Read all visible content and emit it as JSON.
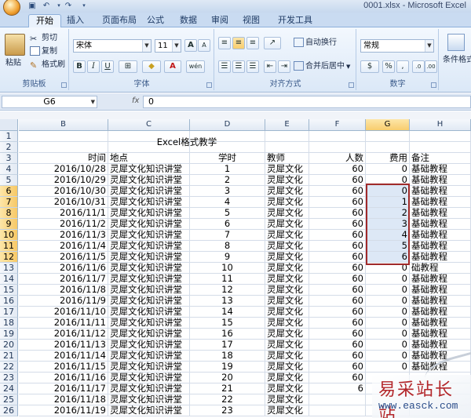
{
  "window": {
    "title": "0001.xlsx - Microsoft Excel"
  },
  "tabs": [
    "开始",
    "插入",
    "页面布局",
    "公式",
    "数据",
    "审阅",
    "视图",
    "开发工具"
  ],
  "ribbon": {
    "clipboard": {
      "label": "剪贴板",
      "paste": "粘贴",
      "cut": "剪切",
      "copy": "复制",
      "format_painter": "格式刷"
    },
    "font": {
      "label": "字体",
      "name": "宋体",
      "size": "11",
      "bold": "B",
      "italic": "I",
      "underline": "U",
      "grow": "A",
      "shrink": "A",
      "wen": "wén"
    },
    "alignment": {
      "label": "对齐方式",
      "wrap": "自动换行",
      "merge": "合并后居中"
    },
    "number": {
      "label": "数字",
      "format": "常规",
      "percent": "%",
      "comma": ","
    },
    "styles": {
      "conditional": "条件格式"
    }
  },
  "formula_bar": {
    "name_box": "G6",
    "fx": "fx",
    "value": "0"
  },
  "sheet": {
    "columns": [
      "B",
      "C",
      "D",
      "E",
      "F",
      "G",
      "H"
    ],
    "selected_column": "G",
    "selected_rows": [
      "6",
      "7",
      "8",
      "9",
      "10",
      "11",
      "12"
    ],
    "title": "Excel格式教学",
    "rows": [
      {
        "n": "1",
        "time": "",
        "place": "",
        "hours": "",
        "teacher": "",
        "count": "",
        "fee": "",
        "note": ""
      },
      {
        "n": "2",
        "time": "",
        "place": "",
        "hours": "",
        "teacher": "",
        "count": "",
        "fee": "",
        "note": ""
      },
      {
        "n": "3",
        "time": "时间",
        "place": "地点",
        "hours": "学时",
        "teacher": "教师",
        "count": "人数",
        "fee": "费用",
        "note": "备注"
      },
      {
        "n": "4",
        "time": "2016/10/28",
        "place": "灵犀文化知识讲堂",
        "hours": "1",
        "teacher": "灵犀文化",
        "count": "60",
        "fee": "0",
        "note": "基础教程"
      },
      {
        "n": "5",
        "time": "2016/10/29",
        "place": "灵犀文化知识讲堂",
        "hours": "2",
        "teacher": "灵犀文化",
        "count": "60",
        "fee": "0",
        "note": "基础教程"
      },
      {
        "n": "6",
        "time": "2016/10/30",
        "place": "灵犀文化知识讲堂",
        "hours": "3",
        "teacher": "灵犀文化",
        "count": "60",
        "fee": "0",
        "note": "基础教程"
      },
      {
        "n": "7",
        "time": "2016/10/31",
        "place": "灵犀文化知识讲堂",
        "hours": "4",
        "teacher": "灵犀文化",
        "count": "60",
        "fee": "1",
        "note": "基础教程"
      },
      {
        "n": "8",
        "time": "2016/11/1",
        "place": "灵犀文化知识讲堂",
        "hours": "5",
        "teacher": "灵犀文化",
        "count": "60",
        "fee": "2",
        "note": "基础教程"
      },
      {
        "n": "9",
        "time": "2016/11/2",
        "place": "灵犀文化知识讲堂",
        "hours": "6",
        "teacher": "灵犀文化",
        "count": "60",
        "fee": "3",
        "note": "基础教程"
      },
      {
        "n": "10",
        "time": "2016/11/3",
        "place": "灵犀文化知识讲堂",
        "hours": "7",
        "teacher": "灵犀文化",
        "count": "60",
        "fee": "4",
        "note": "基础教程"
      },
      {
        "n": "11",
        "time": "2016/11/4",
        "place": "灵犀文化知识讲堂",
        "hours": "8",
        "teacher": "灵犀文化",
        "count": "60",
        "fee": "5",
        "note": "基础教程"
      },
      {
        "n": "12",
        "time": "2016/11/5",
        "place": "灵犀文化知识讲堂",
        "hours": "9",
        "teacher": "灵犀文化",
        "count": "60",
        "fee": "6",
        "note": "基础教程"
      },
      {
        "n": "13",
        "time": "2016/11/6",
        "place": "灵犀文化知识讲堂",
        "hours": "10",
        "teacher": "灵犀文化",
        "count": "60",
        "fee": "0",
        "note": "础教程"
      },
      {
        "n": "14",
        "time": "2016/11/7",
        "place": "灵犀文化知识讲堂",
        "hours": "11",
        "teacher": "灵犀文化",
        "count": "60",
        "fee": "0",
        "note": "基础教程"
      },
      {
        "n": "15",
        "time": "2016/11/8",
        "place": "灵犀文化知识讲堂",
        "hours": "12",
        "teacher": "灵犀文化",
        "count": "60",
        "fee": "0",
        "note": "基础教程"
      },
      {
        "n": "16",
        "time": "2016/11/9",
        "place": "灵犀文化知识讲堂",
        "hours": "13",
        "teacher": "灵犀文化",
        "count": "60",
        "fee": "0",
        "note": "基础教程"
      },
      {
        "n": "17",
        "time": "2016/11/10",
        "place": "灵犀文化知识讲堂",
        "hours": "14",
        "teacher": "灵犀文化",
        "count": "60",
        "fee": "0",
        "note": "基础教程"
      },
      {
        "n": "18",
        "time": "2016/11/11",
        "place": "灵犀文化知识讲堂",
        "hours": "15",
        "teacher": "灵犀文化",
        "count": "60",
        "fee": "0",
        "note": "基础教程"
      },
      {
        "n": "19",
        "time": "2016/11/12",
        "place": "灵犀文化知识讲堂",
        "hours": "16",
        "teacher": "灵犀文化",
        "count": "60",
        "fee": "0",
        "note": "基础教程"
      },
      {
        "n": "20",
        "time": "2016/11/13",
        "place": "灵犀文化知识讲堂",
        "hours": "17",
        "teacher": "灵犀文化",
        "count": "60",
        "fee": "0",
        "note": "基础教程"
      },
      {
        "n": "21",
        "time": "2016/11/14",
        "place": "灵犀文化知识讲堂",
        "hours": "18",
        "teacher": "灵犀文化",
        "count": "60",
        "fee": "0",
        "note": "基础教程"
      },
      {
        "n": "22",
        "time": "2016/11/15",
        "place": "灵犀文化知识讲堂",
        "hours": "19",
        "teacher": "灵犀文化",
        "count": "60",
        "fee": "0",
        "note": "基础教程"
      },
      {
        "n": "23",
        "time": "2016/11/16",
        "place": "灵犀文化知识讲堂",
        "hours": "20",
        "teacher": "灵犀文化",
        "count": "60",
        "fee": "",
        "note": ""
      },
      {
        "n": "24",
        "time": "2016/11/17",
        "place": "灵犀文化知识讲堂",
        "hours": "21",
        "teacher": "灵犀文化",
        "count": "6",
        "fee": "",
        "note": ""
      },
      {
        "n": "25",
        "time": "2016/11/18",
        "place": "灵犀文化知识讲堂",
        "hours": "22",
        "teacher": "灵犀文化",
        "count": "",
        "fee": "",
        "note": ""
      },
      {
        "n": "26",
        "time": "2016/11/19",
        "place": "灵犀文化知识讲堂",
        "hours": "23",
        "teacher": "灵犀文化",
        "count": "",
        "fee": "",
        "note": ""
      }
    ]
  },
  "watermark": {
    "title": "易采站长站",
    "url": "www.easck.com"
  }
}
